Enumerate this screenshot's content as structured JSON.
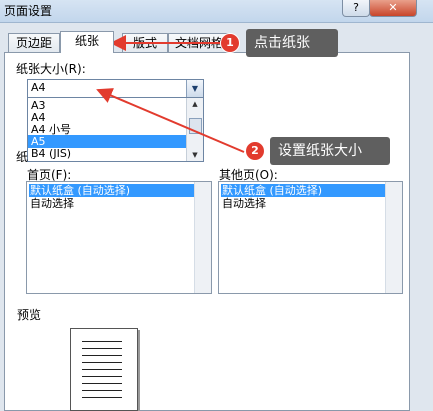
{
  "window": {
    "title": "页面设置",
    "help": "?",
    "close": "✕"
  },
  "tabs": [
    {
      "label": "页边距"
    },
    {
      "label": "纸张"
    },
    {
      "label": "版式"
    },
    {
      "label": "文档网格"
    }
  ],
  "paper_size": {
    "label": "纸张大小(R):",
    "value": "A4",
    "options": [
      "A3",
      "A4",
      "A4 小号",
      "A5",
      "B4 (JIS)"
    ],
    "selected": "A5"
  },
  "paper_source": {
    "label_partial": "纸",
    "first_page": {
      "label": "首页(F):",
      "items": [
        "默认纸盒 (自动选择)",
        "自动选择"
      ]
    },
    "other_pages": {
      "label": "其他页(O):",
      "items": [
        "默认纸盒 (自动选择)",
        "自动选择"
      ]
    }
  },
  "preview": {
    "label": "预览"
  },
  "annotations": [
    {
      "number": "1",
      "text": "点击纸张"
    },
    {
      "number": "2",
      "text": "设置纸张大小"
    }
  ],
  "colors": {
    "accent": "#e23b2e",
    "selection": "#3399ff",
    "callout_bg": "#5f5f5f"
  }
}
